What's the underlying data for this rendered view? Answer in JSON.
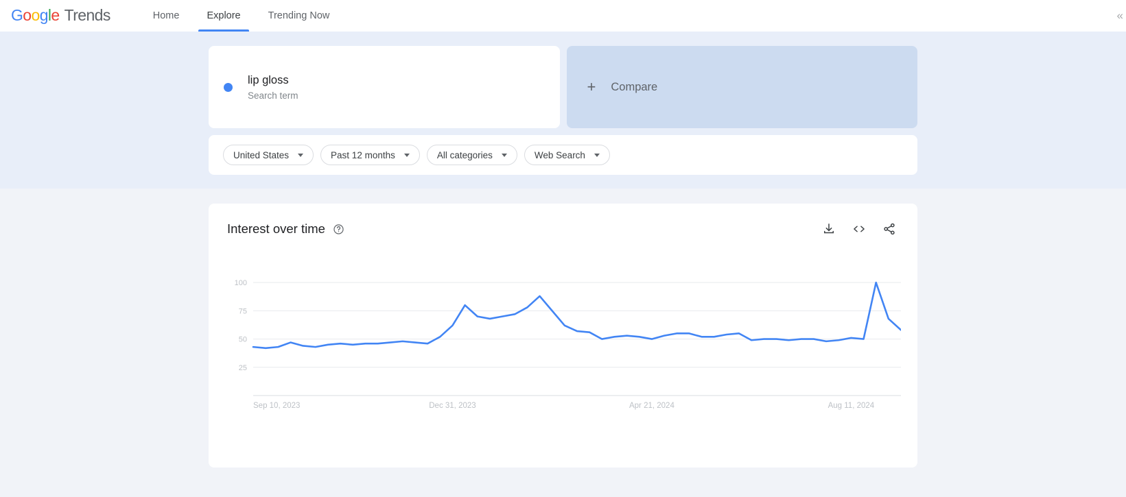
{
  "nav": {
    "logo_google": [
      "G",
      "o",
      "o",
      "g",
      "l",
      "e"
    ],
    "logo_suffix": "Trends",
    "items": [
      {
        "label": "Home",
        "active": false
      },
      {
        "label": "Explore",
        "active": true
      },
      {
        "label": "Trending Now",
        "active": false
      }
    ]
  },
  "query": {
    "term": {
      "name": "lip gloss",
      "type": "Search term",
      "color": "#4285F4"
    },
    "compare": {
      "label": "Compare",
      "icon": "plus-icon"
    }
  },
  "filters": [
    {
      "name": "region",
      "label": "United States"
    },
    {
      "name": "time-range",
      "label": "Past 12 months"
    },
    {
      "name": "category",
      "label": "All categories"
    },
    {
      "name": "search-type",
      "label": "Web Search"
    }
  ],
  "chart_card": {
    "title": "Interest over time",
    "help_icon": "help-circle-icon",
    "actions": [
      {
        "name": "download-csv-button",
        "icon": "download-icon"
      },
      {
        "name": "embed-button",
        "icon": "code-embed-icon"
      },
      {
        "name": "share-button",
        "icon": "share-icon"
      }
    ]
  },
  "chart_data": {
    "type": "line",
    "title": "Interest over time",
    "xlabel": "",
    "ylabel": "",
    "series_name": "lip gloss",
    "series_color": "#4285F4",
    "ylim": [
      0,
      108
    ],
    "yticks": [
      100,
      75,
      50,
      25
    ],
    "grid": true,
    "legend": "none",
    "xtick_labels": [
      "Sep 10, 2023",
      "Dec 31, 2023",
      "Apr 21, 2024",
      "Aug 11, 2024"
    ],
    "xtick_positions": [
      0,
      16,
      32,
      48
    ],
    "x": [
      "Sep 10, 2023",
      "Sep 17, 2023",
      "Sep 24, 2023",
      "Oct 1, 2023",
      "Oct 8, 2023",
      "Oct 15, 2023",
      "Oct 22, 2023",
      "Oct 29, 2023",
      "Nov 5, 2023",
      "Nov 12, 2023",
      "Nov 19, 2023",
      "Nov 26, 2023",
      "Dec 3, 2023",
      "Dec 10, 2023",
      "Dec 17, 2023",
      "Dec 24, 2023",
      "Dec 31, 2023",
      "Jan 7, 2024",
      "Jan 14, 2024",
      "Jan 21, 2024",
      "Jan 28, 2024",
      "Feb 4, 2024",
      "Feb 11, 2024",
      "Feb 18, 2024",
      "Feb 25, 2024",
      "Mar 3, 2024",
      "Mar 10, 2024",
      "Mar 17, 2024",
      "Mar 24, 2024",
      "Mar 31, 2024",
      "Apr 7, 2024",
      "Apr 14, 2024",
      "Apr 21, 2024",
      "Apr 28, 2024",
      "May 5, 2024",
      "May 12, 2024",
      "May 19, 2024",
      "May 26, 2024",
      "Jun 2, 2024",
      "Jun 9, 2024",
      "Jun 16, 2024",
      "Jun 23, 2024",
      "Jun 30, 2024",
      "Jul 7, 2024",
      "Jul 14, 2024",
      "Jul 21, 2024",
      "Jul 28, 2024",
      "Aug 4, 2024",
      "Aug 11, 2024",
      "Aug 18, 2024",
      "Aug 25, 2024",
      "Sep 1, 2024",
      "Sep 8, 2024"
    ],
    "values": [
      43,
      42,
      43,
      47,
      44,
      43,
      45,
      46,
      45,
      46,
      46,
      47,
      48,
      47,
      46,
      52,
      62,
      80,
      70,
      68,
      70,
      72,
      78,
      88,
      75,
      62,
      57,
      56,
      50,
      52,
      53,
      52,
      50,
      53,
      55,
      55,
      52,
      52,
      54,
      55,
      49,
      50,
      50,
      49,
      50,
      50,
      48,
      49,
      51,
      50,
      100,
      68,
      58
    ]
  }
}
